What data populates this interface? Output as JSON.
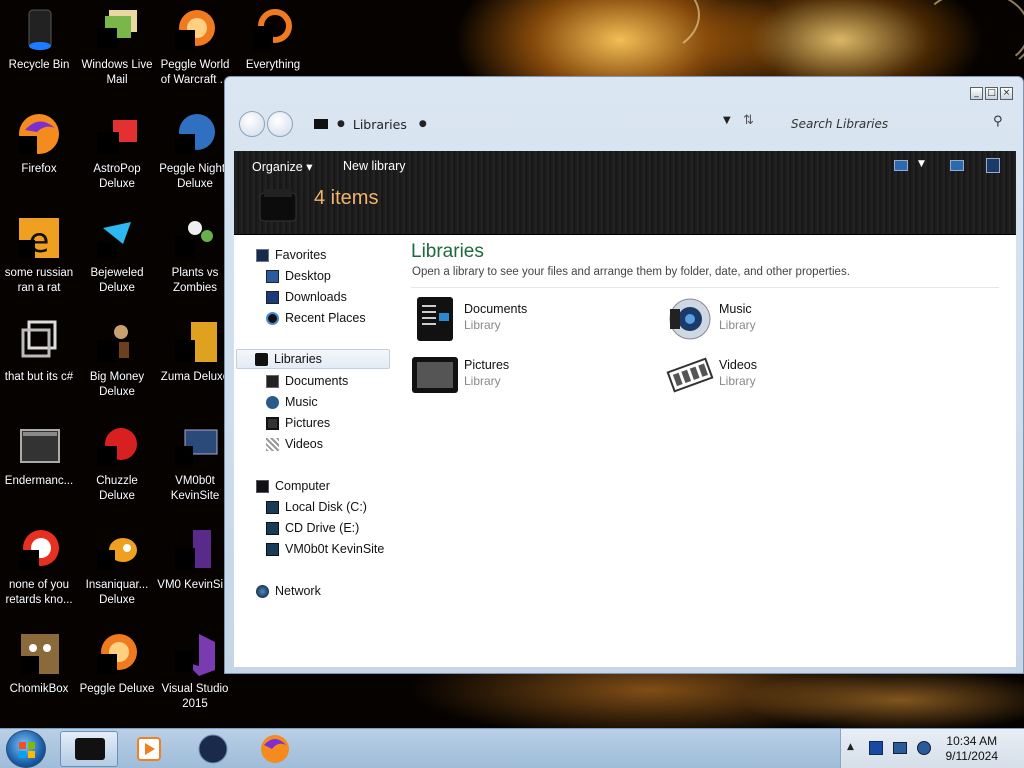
{
  "desktop_icons": [
    {
      "label": "Recycle Bin",
      "icon": "recycle-bin-icon"
    },
    {
      "label": "Windows Live Mail",
      "icon": "mail-icon"
    },
    {
      "label": "Peggle World of Warcraft ...",
      "icon": "peggle-icon"
    },
    {
      "label": "Everything",
      "icon": "search-app-icon"
    },
    {
      "label": "Firefox",
      "icon": "firefox-icon"
    },
    {
      "label": "AstroPop Deluxe",
      "icon": "game-icon"
    },
    {
      "label": "Peggle Nights Deluxe",
      "icon": "game-icon"
    },
    {
      "label": "some russian ran a rat",
      "icon": "app-icon"
    },
    {
      "label": "Bejeweled Deluxe",
      "icon": "gem-icon"
    },
    {
      "label": "Plants vs Zombies",
      "icon": "plant-icon"
    },
    {
      "label": "that but its c#",
      "icon": "shortcut-icon"
    },
    {
      "label": "Big Money Deluxe",
      "icon": "game-icon"
    },
    {
      "label": "Zuma Deluxe",
      "icon": "game-icon"
    },
    {
      "label": "Endermanc...",
      "icon": "window-icon"
    },
    {
      "label": "Chuzzle Deluxe",
      "icon": "game-icon"
    },
    {
      "label": "VM0b0t KevinSite",
      "icon": "computer-icon"
    },
    {
      "label": "none of you retards kno...",
      "icon": "app-icon"
    },
    {
      "label": "Insaniquar... Deluxe",
      "icon": "fish-icon"
    },
    {
      "label": "VM0 KevinSi...",
      "icon": "file-icon"
    },
    {
      "label": "ChomikBox",
      "icon": "hamster-icon"
    },
    {
      "label": "Peggle Deluxe",
      "icon": "peggle-icon"
    },
    {
      "label": "Visual Studio 2015",
      "icon": "visual-studio-icon"
    }
  ],
  "window": {
    "address": {
      "segment": "Libraries"
    },
    "search_placeholder": "Search Libraries",
    "toolbar": {
      "organize": "Organize",
      "new_library": "New library",
      "item_count": "4 items"
    },
    "nav": {
      "favorites": "Favorites",
      "favorites_items": [
        "Desktop",
        "Downloads",
        "Recent Places"
      ],
      "libraries": "Libraries",
      "libraries_items": [
        "Documents",
        "Music",
        "Pictures",
        "Videos"
      ],
      "computer": "Computer",
      "computer_items": [
        "Local Disk (C:)",
        "CD Drive (E:)",
        "VM0b0t KevinSite"
      ],
      "network": "Network"
    },
    "main": {
      "title": "Libraries",
      "description": "Open a library to see your files and arrange them by folder, date, and other properties.",
      "items": [
        {
          "name": "Documents",
          "type": "Library",
          "icon": "documents-library-icon"
        },
        {
          "name": "Music",
          "type": "Library",
          "icon": "music-library-icon"
        },
        {
          "name": "Pictures",
          "type": "Library",
          "icon": "pictures-library-icon"
        },
        {
          "name": "Videos",
          "type": "Library",
          "icon": "videos-library-icon"
        }
      ]
    }
  },
  "taskbar": {
    "clock_time": "10:34 AM",
    "clock_date": "9/11/2024"
  }
}
